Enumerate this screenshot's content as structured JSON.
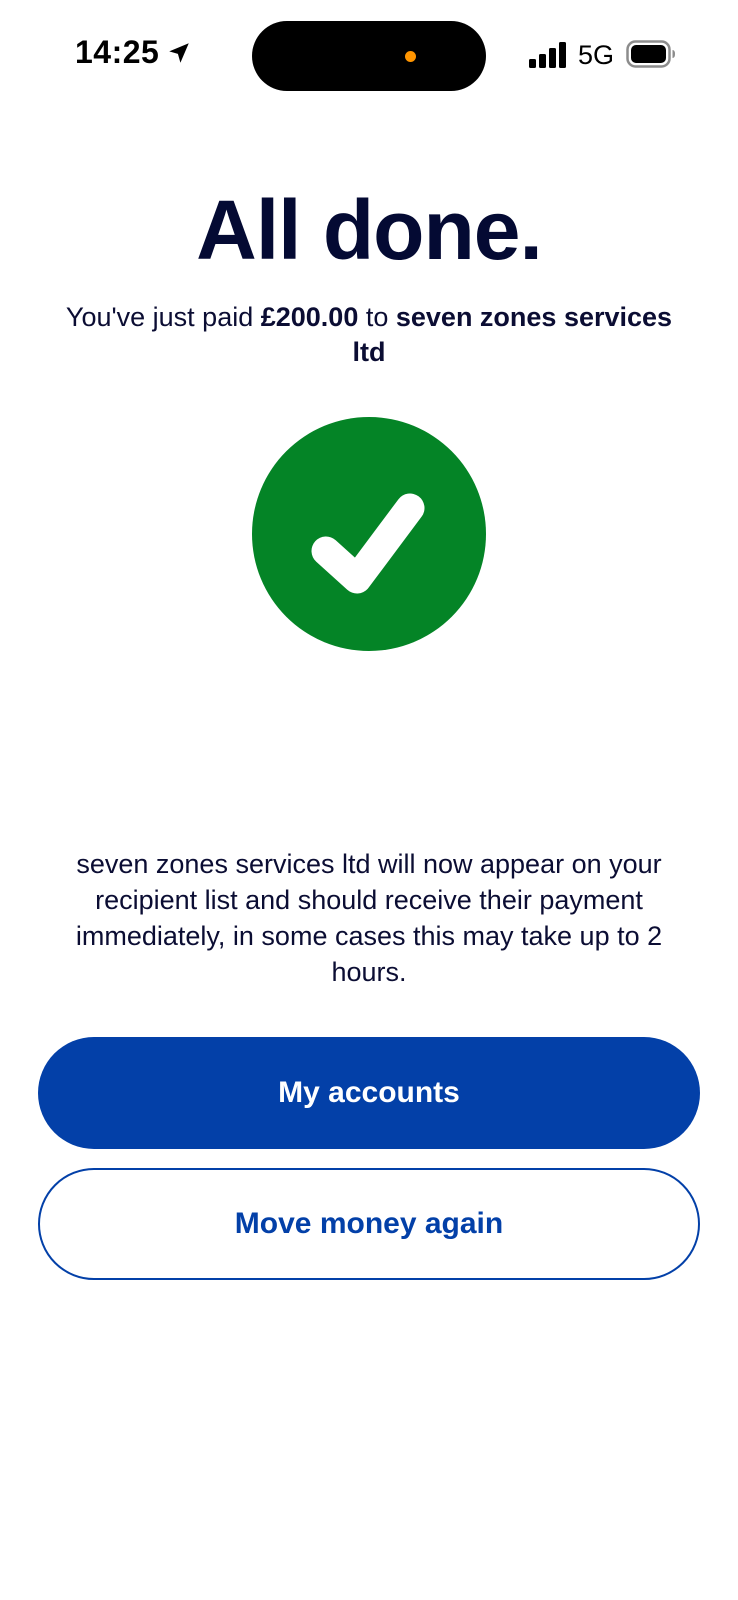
{
  "status_bar": {
    "time": "14:25",
    "network": "5G",
    "icons": [
      "location-arrow-icon",
      "signal-bars-icon",
      "battery-icon"
    ],
    "privacy_dot_color": "#ff9500"
  },
  "confirmation": {
    "title": "All done.",
    "summary_prefix": "You've just paid ",
    "amount": "£200.00",
    "summary_middle": " to ",
    "recipient": "seven zones services ltd",
    "status_icon": "checkmark-circle-icon",
    "status_color": "#048426",
    "info": "seven zones services ltd will now appear on your recipient list and should receive their payment immediately, in some cases this may take up to 2 hours."
  },
  "actions": {
    "primary_label": "My accounts",
    "secondary_label": "Move money again",
    "accent_color": "#0340a8"
  }
}
